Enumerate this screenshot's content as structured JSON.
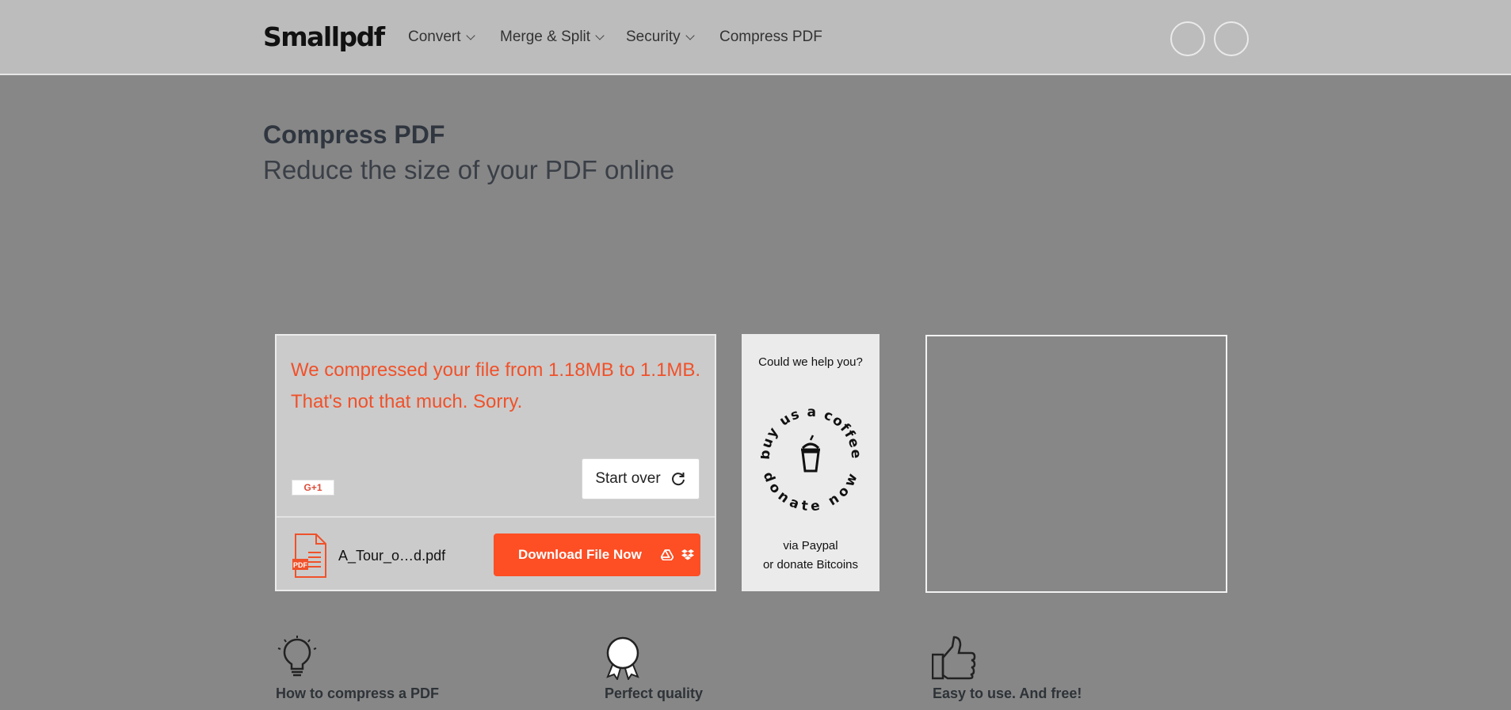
{
  "header": {
    "logo": "Smallpdf",
    "nav": [
      {
        "label": "Convert",
        "dropdown": true
      },
      {
        "label": "Merge & Split",
        "dropdown": true
      },
      {
        "label": "Security",
        "dropdown": true
      },
      {
        "label": "Compress PDF",
        "dropdown": false
      }
    ]
  },
  "page": {
    "title": "Compress PDF",
    "subtitle": "Reduce the size of your PDF online"
  },
  "result": {
    "message_line1": "We compressed your file from 1.18MB to 1.1MB.",
    "message_line2": "That's not that much. Sorry.",
    "gplus_label": "G+1",
    "start_over_label": "Start over",
    "file_name": "A_Tour_o…d.pdf",
    "file_badge": "PDF",
    "download_label": "Download File Now"
  },
  "donate": {
    "question": "Could we help you?",
    "ring_top": "buy us a coffee",
    "ring_bottom": "donate now",
    "via_line1": "via Paypal",
    "via_line2": "or donate Bitcoins"
  },
  "features": [
    {
      "label": "How to compress a PDF",
      "icon": "lightbulb-icon"
    },
    {
      "label": "Perfect quality",
      "icon": "award-ribbon-icon"
    },
    {
      "label": "Easy to use. And free!",
      "icon": "thumbs-up-icon"
    }
  ],
  "colors": {
    "accent": "#fd4e24",
    "message": "#f0512a",
    "overlay": "#878787",
    "header": "#bcbcbc"
  }
}
